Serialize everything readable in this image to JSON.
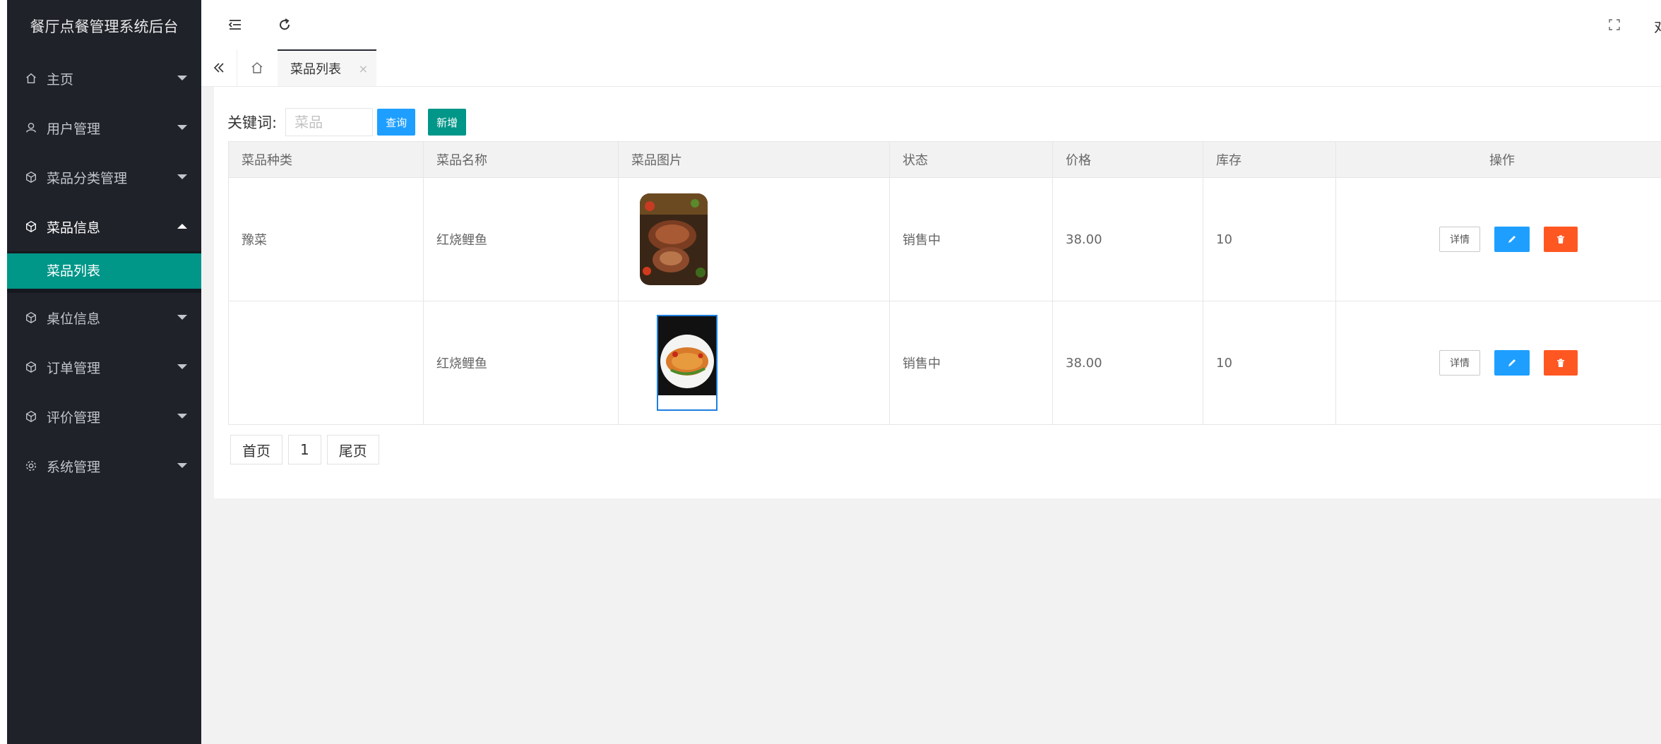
{
  "app": {
    "title": "餐厅点餐管理系统后台"
  },
  "sidebar": {
    "items": [
      {
        "label": "主页",
        "icon": "home-icon",
        "open": false
      },
      {
        "label": "用户管理",
        "icon": "user-icon",
        "open": false
      },
      {
        "label": "菜品分类管理",
        "icon": "cube-icon",
        "open": false
      },
      {
        "label": "菜品信息",
        "icon": "cube-icon",
        "open": true
      },
      {
        "label": "桌位信息",
        "icon": "cube-icon",
        "open": false
      },
      {
        "label": "订单管理",
        "icon": "cube-icon",
        "open": false
      },
      {
        "label": "评价管理",
        "icon": "cube-icon",
        "open": false
      },
      {
        "label": "系统管理",
        "icon": "gear-icon",
        "open": false
      }
    ],
    "submenu": {
      "label": "菜品列表"
    }
  },
  "topbar": {
    "icons": [
      "menu-fold-icon",
      "refresh-icon",
      "fullscreen-icon"
    ],
    "cut_text": "对"
  },
  "tabs": {
    "active": {
      "label": "菜品列表",
      "close": "×"
    }
  },
  "search": {
    "label": "关键词:",
    "placeholder": "菜品",
    "value": "",
    "query_label": "查询",
    "add_label": "新增"
  },
  "table": {
    "headers": [
      "菜品种类",
      "菜品名称",
      "菜品图片",
      "状态",
      "价格",
      "库存",
      "操作"
    ],
    "rows": [
      {
        "category": "豫菜",
        "name": "红烧鲤鱼",
        "status": "销售中",
        "price": "38.00",
        "stock": "10"
      },
      {
        "category": "",
        "name": "红烧鲤鱼",
        "status": "销售中",
        "price": "38.00",
        "stock": "10"
      }
    ],
    "detail_label": "详情"
  },
  "pager": {
    "first": "首页",
    "page": "1",
    "last": "尾页"
  },
  "colors": {
    "sidebar_bg": "#20222a",
    "accent": "#009688",
    "blue": "#1e9fff",
    "danger": "#ff5722",
    "status": "#ff0000"
  }
}
